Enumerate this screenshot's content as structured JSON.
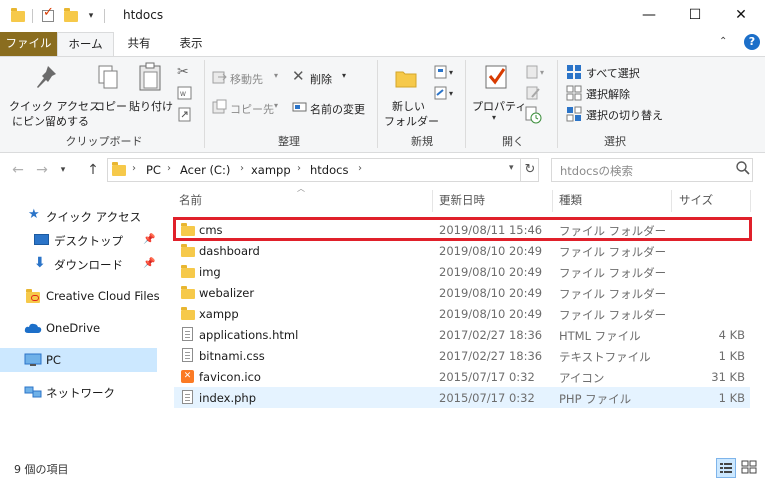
{
  "window": {
    "title": "htdocs",
    "minimize": "—",
    "maximize": "☐",
    "close": "✕"
  },
  "ribbon_tabs": [
    "ファイル",
    "ホーム",
    "共有",
    "表示"
  ],
  "ribbon": {
    "clipboard": {
      "label": "クリップボード",
      "pin_line1": "クイック アクセス",
      "pin_line2": "にピン留めする",
      "copy": "コピー",
      "paste": "貼り付け"
    },
    "organize": {
      "label": "整理",
      "move_to": "移動先",
      "copy_to": "コピー先",
      "delete": "削除",
      "rename": "名前の変更"
    },
    "new": {
      "label": "新規",
      "new_folder_line1": "新しい",
      "new_folder_line2": "フォルダー"
    },
    "open": {
      "label": "開く",
      "properties": "プロパティ"
    },
    "select": {
      "label": "選択",
      "select_all": "すべて選択",
      "select_none": "選択解除",
      "invert": "選択の切り替え"
    }
  },
  "address": {
    "crumbs": [
      "PC",
      "Acer (C:)",
      "xampp",
      "htdocs"
    ]
  },
  "search": {
    "placeholder": "htdocsの検索"
  },
  "nav_pane": {
    "quick_access": "クイック アクセス",
    "desktop": "デスクトップ",
    "downloads": "ダウンロード",
    "creative_cloud": "Creative Cloud Files",
    "onedrive": "OneDrive",
    "pc": "PC",
    "network": "ネットワーク"
  },
  "columns": {
    "name": "名前",
    "modified": "更新日時",
    "type": "種類",
    "size": "サイズ"
  },
  "files": [
    {
      "name": "cms",
      "modified": "2019/08/11 15:46",
      "type": "ファイル フォルダー",
      "size": "",
      "icon": "folder-icon"
    },
    {
      "name": "dashboard",
      "modified": "2019/08/10 20:49",
      "type": "ファイル フォルダー",
      "size": "",
      "icon": "folder-icon"
    },
    {
      "name": "img",
      "modified": "2019/08/10 20:49",
      "type": "ファイル フォルダー",
      "size": "",
      "icon": "folder-icon"
    },
    {
      "name": "webalizer",
      "modified": "2019/08/10 20:49",
      "type": "ファイル フォルダー",
      "size": "",
      "icon": "folder-icon"
    },
    {
      "name": "xampp",
      "modified": "2019/08/10 20:49",
      "type": "ファイル フォルダー",
      "size": "",
      "icon": "folder-icon"
    },
    {
      "name": "applications.html",
      "modified": "2017/02/27 18:36",
      "type": "HTML ファイル",
      "size": "4 KB",
      "icon": "document-icon"
    },
    {
      "name": "bitnami.css",
      "modified": "2017/02/27 18:36",
      "type": "テキストファイル",
      "size": "1 KB",
      "icon": "document-icon"
    },
    {
      "name": "favicon.ico",
      "modified": "2015/07/17 0:32",
      "type": "アイコン",
      "size": "31 KB",
      "icon": "xampp-icon"
    },
    {
      "name": "index.php",
      "modified": "2015/07/17 0:32",
      "type": "PHP ファイル",
      "size": "1 KB",
      "icon": "document-icon"
    }
  ],
  "status": {
    "item_count": "9 個の項目"
  },
  "colors": {
    "file_tab": "#8a6d1f",
    "selection": "#cce8ff",
    "hover_row": "#e5f3ff",
    "highlight_box": "#e0202a",
    "folder": "#f6c94a"
  }
}
